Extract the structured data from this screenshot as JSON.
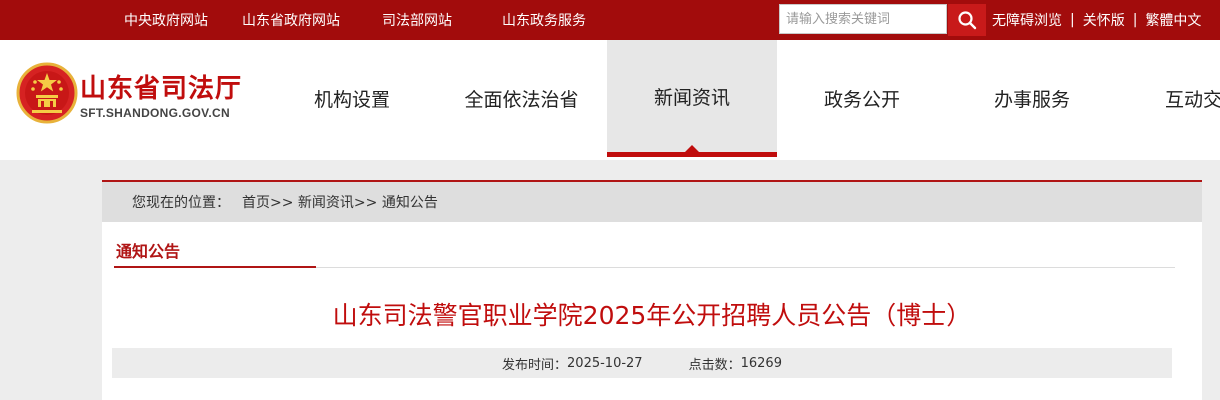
{
  "topbar": {
    "links": [
      "中央政府网站",
      "山东省政府网站",
      "司法部网站",
      "山东政务服务"
    ],
    "search_placeholder": "请输入搜索关键词",
    "accessibility": "无障碍浏览",
    "care_mode": "关怀版",
    "traditional": "繁體中文",
    "separator": "|"
  },
  "header": {
    "site_name": "山东省司法厅",
    "site_domain": "SFT.SHANDONG.GOV.CN",
    "nav": [
      "机构设置",
      "全面依法治省",
      "新闻资讯",
      "政务公开",
      "办事服务",
      "互动交流"
    ],
    "active_nav_index": 2
  },
  "breadcrumb": {
    "label": "您现在的位置：",
    "path": "首页>> 新闻资讯>> 通知公告"
  },
  "section": {
    "title": "通知公告"
  },
  "article": {
    "title": "山东司法警官职业学院2025年公开招聘人员公告（博士）",
    "publish_label": "发布时间：",
    "publish_date": "2025-10-27",
    "clicks_label": "点击数：",
    "clicks": "16269"
  },
  "colors": {
    "primary_red": "#a20c0c",
    "accent_red": "#c00d0d",
    "search_button": "#c81a1a"
  },
  "icons": {
    "search": "search-icon",
    "emblem": "national-emblem-icon"
  }
}
